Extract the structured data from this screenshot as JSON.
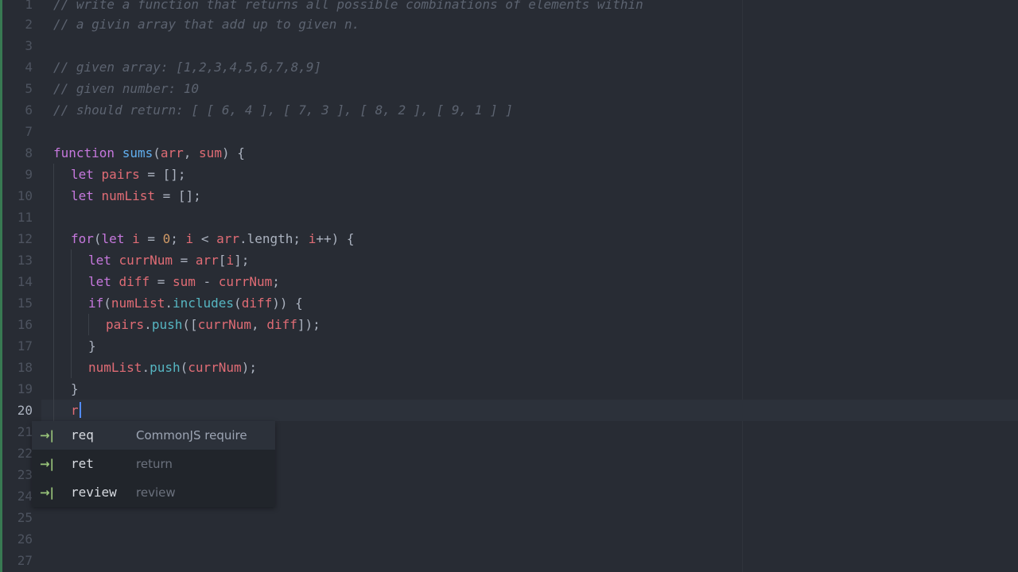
{
  "editor": {
    "language": "javascript",
    "theme_colors": {
      "background": "#282c34",
      "comment": "#5c6370",
      "keyword": "#c678dd",
      "function": "#61afef",
      "variable": "#e06c75",
      "number": "#d19a66",
      "method": "#56b6c2",
      "accent": "#528bff"
    },
    "active_line": "20",
    "line_numbers": [
      "1",
      "2",
      "3",
      "4",
      "5",
      "6",
      "7",
      "8",
      "9",
      "10",
      "11",
      "12",
      "13",
      "14",
      "15",
      "16",
      "17",
      "18",
      "19",
      "20",
      "21",
      "22",
      "23",
      "24",
      "25",
      "26",
      "27"
    ],
    "code": {
      "l1": "// write a function that returns all possible combinations of elements within",
      "l2": "// a givin array that add up to given n.",
      "l4": "// given array: [1,2,3,4,5,6,7,8,9]",
      "l5": "// given number: 10",
      "l6": "// should return: [ [ 6, 4 ], [ 7, 3 ], [ 8, 2 ], [ 9, 1 ] ]",
      "l8": {
        "kw": "function",
        "name": "sums",
        "open": "(",
        "arg1": "arr",
        "sep": ", ",
        "arg2": "sum",
        "close": ") {"
      },
      "l9": {
        "kw": "let",
        "name": "pairs",
        "rest": " = [];"
      },
      "l10": {
        "kw": "let",
        "name": "numList",
        "rest": " = [];"
      },
      "l12": {
        "kw1": "for",
        "p1": "(",
        "kw2": "let",
        "v1": "i",
        "p2": " = ",
        "num": "0",
        "p3": "; ",
        "v2": "i",
        "p4": " < ",
        "v3": "arr",
        "p5": ".length; ",
        "v4": "i",
        "p6": "++) {"
      },
      "l13": {
        "kw": "let",
        "name": "currNum",
        "p1": " = ",
        "v1": "arr",
        "p2": "[",
        "v2": "i",
        "p3": "];"
      },
      "l14": {
        "kw": "let",
        "name": "diff",
        "p1": " = ",
        "v1": "sum",
        "p2": " - ",
        "v2": "currNum",
        "p3": ";"
      },
      "l15": {
        "kw": "if",
        "p1": "(",
        "v1": "numList",
        "p2": ".",
        "m1": "includes",
        "p3": "(",
        "v2": "diff",
        "p4": ")) {"
      },
      "l16": {
        "v1": "pairs",
        "p1": ".",
        "m1": "push",
        "p2": "([",
        "v2": "currNum",
        "p3": ", ",
        "v3": "diff",
        "p4": "]);"
      },
      "l17": "}",
      "l18": {
        "v1": "numList",
        "p1": ".",
        "m1": "push",
        "p2": "(",
        "v2": "currNum",
        "p3": ");"
      },
      "l19": "}",
      "l20": "r"
    }
  },
  "autocomplete": {
    "items": [
      {
        "icon": "tab-key-icon",
        "glyph": "→|",
        "word": "req",
        "description": "CommonJS require",
        "selected": true
      },
      {
        "icon": "tab-key-icon",
        "glyph": "→|",
        "word": "ret",
        "description": "return",
        "selected": false
      },
      {
        "icon": "tab-key-icon",
        "glyph": "→|",
        "word": "review",
        "description": "review",
        "selected": false
      }
    ]
  }
}
